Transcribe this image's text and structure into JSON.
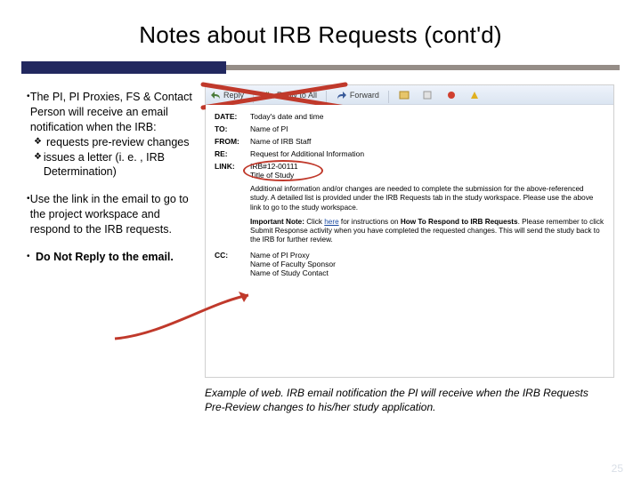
{
  "title": "Notes about IRB Requests (cont'd)",
  "left": {
    "p1_intro": "The PI, PI Proxies, FS & Contact Person will receive an email notification when the IRB:",
    "sub1": "requests pre-review changes",
    "sub2": "issues a letter (i. e. , IRB Determination)",
    "p2": "Use the link in the email to go to the project workspace and respond to the IRB requests.",
    "p3": "Do Not Reply to the email."
  },
  "toolbar": {
    "reply": "Reply",
    "replyall": "Reply to All",
    "forward": "Forward"
  },
  "email": {
    "date_label": "DATE:",
    "date_val": "Today's date and time",
    "to_label": "TO:",
    "to_val": "Name of PI",
    "from_label": "FROM:",
    "from_val": "Name of IRB Staff",
    "re_label": "RE:",
    "re_val": "Request for Additional Information",
    "link_label": "LINK:",
    "link_val1": "IRB#12-00111",
    "link_val2": "Title of Study",
    "body1": "Additional information and/or changes are needed to complete the submission for the above-referenced study.  A detailed list is provided under the IRB Requests tab in the study workspace.  Please use the above link to go to the study workspace.",
    "imp_lead": "Important Note:",
    "imp_click": " Click ",
    "imp_here": "here",
    "imp_mid": " for instructions on ",
    "imp_howto": "How To Respond to IRB Requests",
    "imp_rest": ".  Please remember to click Submit Response activity when you have completed the requested changes.  This will send the study back to the IRB for further review.",
    "cc_label": "CC:",
    "cc_v1": "Name of PI Proxy",
    "cc_v2": "Name of Faculty Sponsor",
    "cc_v3": "Name of Study Contact"
  },
  "caption": "Example of web. IRB email notification the PI will receive when the IRB Requests Pre-Review changes to his/her study application.",
  "page_num": "25"
}
